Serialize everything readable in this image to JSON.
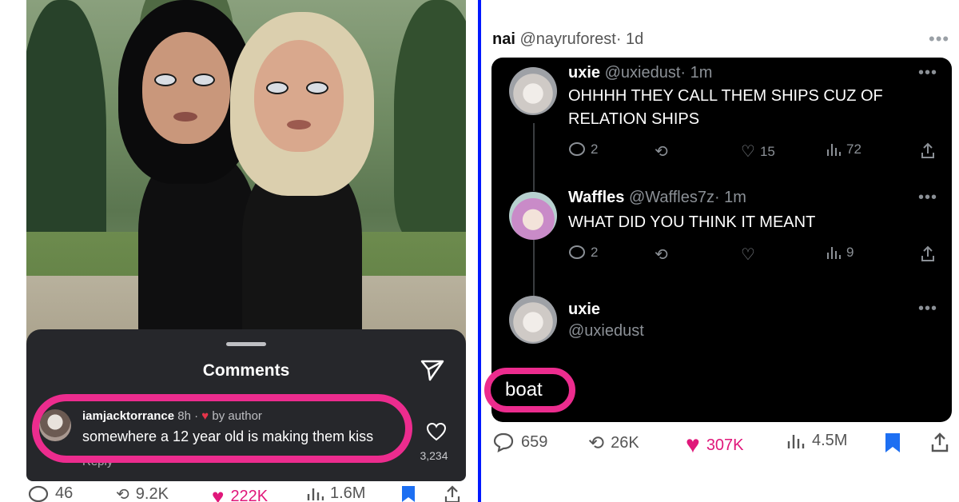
{
  "left_post": {
    "comments_sheet": {
      "title": "Comments",
      "comment": {
        "username": "iamjacktorrance",
        "time": "8h",
        "separator": "·",
        "by_author": "by author",
        "text": "somewhere a 12 year old is making them kiss",
        "reply_label": "Reply",
        "like_count": "3,234"
      }
    },
    "actions": {
      "comments": "46",
      "reposts": "9.2K",
      "likes": "222K",
      "views": "1.6M"
    }
  },
  "right_post": {
    "author_name": "nai",
    "author_handle": "@nayruforest",
    "time": "· 1d",
    "quoted_thread": [
      {
        "name": "uxie",
        "handle": "@uxiedust",
        "time": "· 1m",
        "text": "OHHHH THEY CALL THEM SHIPS CUZ OF RELATION SHIPS",
        "replies": "2",
        "reposts": "",
        "likes": "15",
        "views": "72"
      },
      {
        "name": "Waffles",
        "handle": "@Waffles7z",
        "time": "· 1m",
        "text": "WHAT DID YOU THINK IT MEANT",
        "replies": "2",
        "reposts": "",
        "likes": "",
        "views": "9"
      },
      {
        "name": "uxie",
        "handle": "@uxiedust"
      }
    ],
    "reply_text": "boat",
    "actions": {
      "replies": "659",
      "reposts": "26K",
      "likes": "307K",
      "views": "4.5M"
    }
  },
  "colors": {
    "highlight": "#ec2c8e",
    "divider": "#0019ff",
    "like_pink": "#e0177a",
    "bookmark_blue": "#1d6ff2",
    "dark_sheet": "#26272b"
  },
  "icons": [
    "send-icon",
    "heart-icon",
    "comment-icon",
    "repost-icon",
    "views-icon",
    "bookmark-icon",
    "share-icon",
    "more-icon"
  ]
}
